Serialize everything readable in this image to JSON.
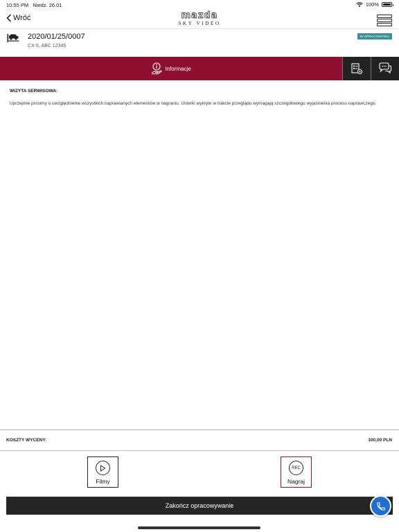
{
  "status_bar": {
    "time": "10:55 PM",
    "date": "Niedz. 26.01",
    "battery": "100%",
    "battery_level": 1.0
  },
  "nav": {
    "back_label": "Wróć",
    "logo_brand": "mazda",
    "logo_sub": "SKY VIDEO",
    "icons": {
      "back": "chevron-left-icon",
      "menu": "hamburger-menu-icon"
    }
  },
  "header": {
    "order_number": "2020/01/25/0007",
    "vehicle": "CX-5, ABC 12345",
    "status_badge": "W OPRACOWANIU",
    "icons": {
      "vehicle": "car-lift-icon"
    }
  },
  "tabs": {
    "info_label": "Informacje",
    "icons": {
      "info": "info-hand-icon",
      "doc": "document-settings-icon",
      "chat": "chat-bubbles-icon"
    }
  },
  "content": {
    "section_title": "WIZYTA SERWISOWA:",
    "section_text": "Uprzejmie prosimy o uwzględnienie wszystkich naprawianych elementów w nagraniu. Usterki wykryte w trakcie przeglądu wymagają szczegółowego wyjaśnienia procesu naprawczego."
  },
  "costs": {
    "label": "KOSZTY WYCENY:",
    "value": "100,00 PLN"
  },
  "actions": {
    "films_label": "Filmy",
    "rec_label": "Nagraj",
    "rec_icon_text": "REC"
  },
  "finish": {
    "label": "Zakończ opracowywanie"
  },
  "colors": {
    "accent": "#8e0f2f",
    "badge": "#3a8f95",
    "dark": "#262626",
    "call": "#1f6fd1"
  }
}
